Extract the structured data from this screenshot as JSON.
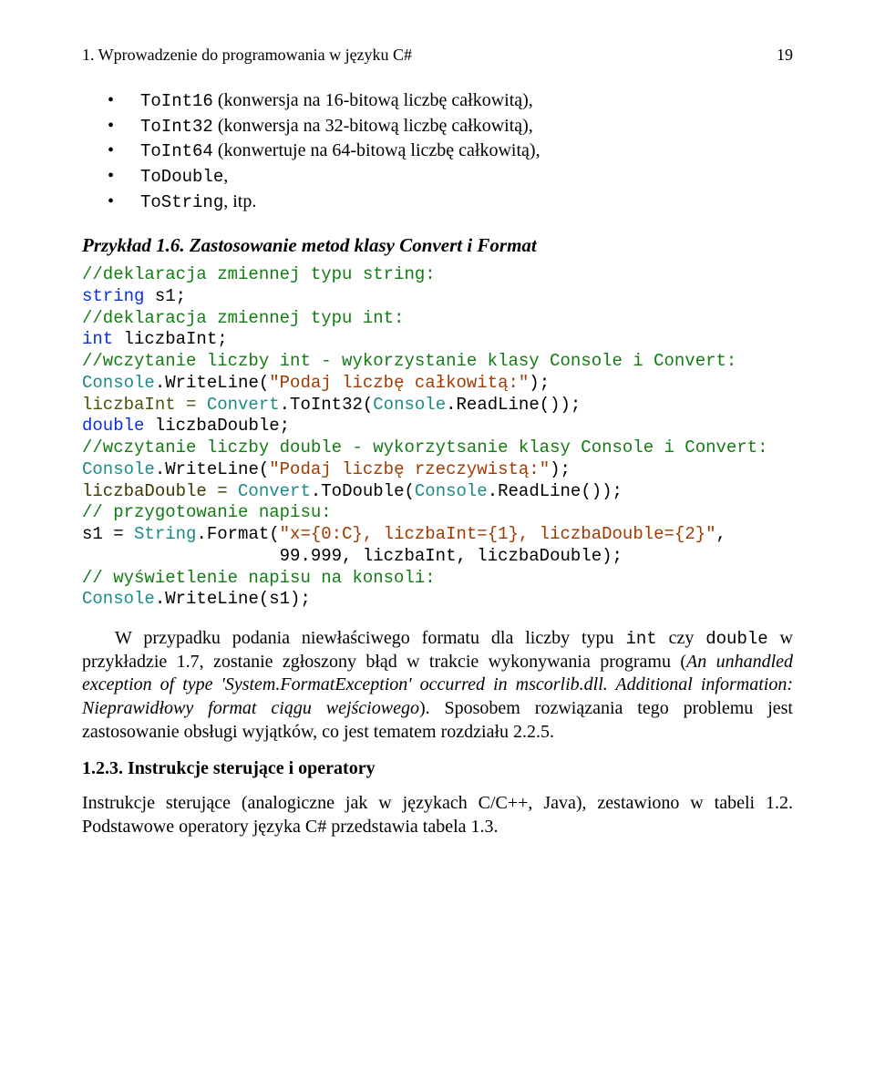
{
  "header": {
    "title": "1. Wprowadzenie do programowania w języku C#",
    "page": "19"
  },
  "bullets": [
    {
      "code": "ToInt16",
      "text": " (konwersja na 16-bitową liczbę całkowitą),"
    },
    {
      "code": "ToInt32",
      "text": " (konwersja na 32-bitową liczbę całkowitą),"
    },
    {
      "code": "ToInt64",
      "text": " (konwertuje na 64-bitową liczbę całkowitą),"
    },
    {
      "code": "ToDouble",
      "text": ","
    },
    {
      "code": "ToString",
      "text": ", itp."
    }
  ],
  "example_heading": "Przykład 1.6. Zastosowanie metod klasy Convert i Format",
  "code": {
    "l1": "//deklaracja zmiennej typu string:",
    "l2a": "string",
    "l2b": " s1;",
    "l3": "//deklaracja zmiennej typu int:",
    "l4a": "int",
    "l4b": " liczbaInt;",
    "l5": "//wczytanie liczby int - wykorzystanie klasy Console i Convert:",
    "l6a": "Console",
    "l6b": ".WriteLine(",
    "l6c": "\"Podaj liczbę całkowitą:\"",
    "l6d": ");",
    "l7a": "liczbaInt = ",
    "l7b": "Convert",
    "l7c": ".ToInt32(",
    "l7d": "Console",
    "l7e": ".ReadLine());",
    "l8a": "double",
    "l8b": " liczbaDouble;",
    "l9": "//wczytanie liczby double - wykorzytsanie klasy Console i Convert:",
    "l10a": "Console",
    "l10b": ".WriteLine(",
    "l10c": "\"Podaj liczbę rzeczywistą:\"",
    "l10d": ");",
    "l11a": "liczbaDouble = ",
    "l11b": "Convert",
    "l11c": ".ToDouble(",
    "l11d": "Console",
    "l11e": ".ReadLine());",
    "l12": "// przygotowanie napisu:",
    "l13a": "s1 = ",
    "l13b": "String",
    "l13c": ".Format(",
    "l13d": "\"x={0:C}, liczbaInt={1}, liczbaDouble={2}\"",
    "l13e": ",",
    "l14": "                   99.999, liczbaInt, liczbaDouble);",
    "l15": "// wyświetlenie napisu na konsoli:",
    "l16a": "Console",
    "l16b": ".WriteLine(s1);"
  },
  "para1": {
    "p1": "W przypadku podania niewłaściwego formatu dla liczby typu ",
    "m1": "int",
    "p2": "  czy ",
    "m2": "double",
    "p3": "  w przykładzie 1.7, zostanie zgłoszony błąd w trakcie wykonywania programu (",
    "it1": "An unhandled exception of type 'System.FormatException' occurred in mscorlib.dll. Additional information: Nieprawidłowy format ciągu wejściowego",
    "p4": "). Sposobem rozwiązania tego problemu jest zastosowanie obsługi wyjątków, co jest tematem rozdziału 2.2.5."
  },
  "section": "1.2.3. Instrukcje sterujące i operatory",
  "para2": "Instrukcje sterujące (analogiczne jak w  językach C/C++, Java), zestawiono w tabeli 1.2. Podstawowe operatory  języka C# przedstawia tabela 1.3."
}
